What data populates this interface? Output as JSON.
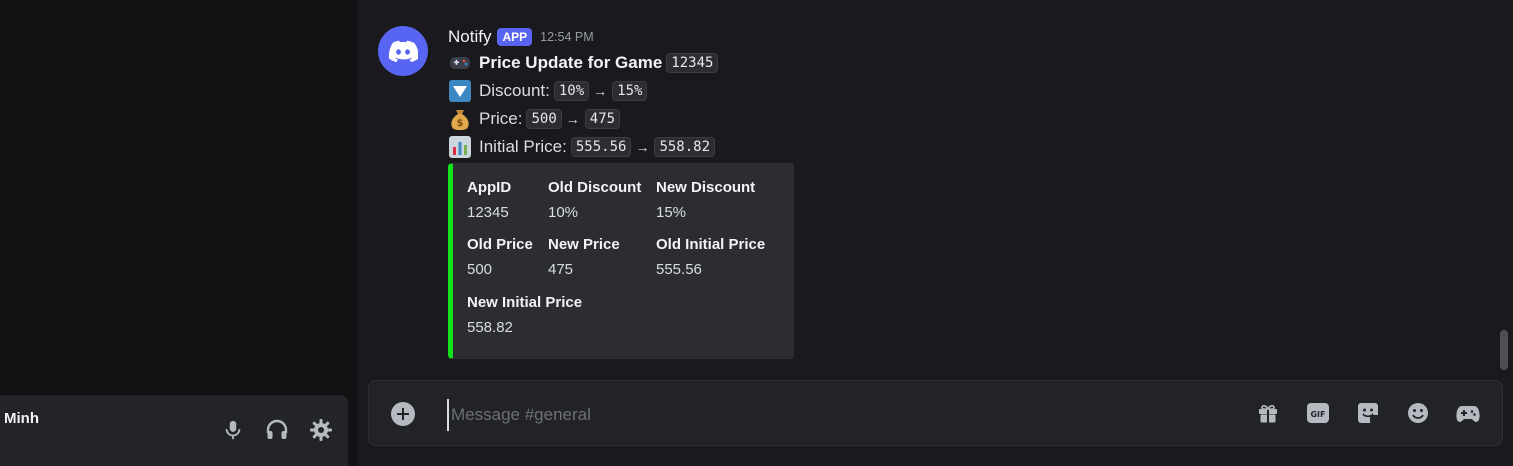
{
  "user_panel": {
    "username": "Minh"
  },
  "message": {
    "author": "Notify",
    "badge": "APP",
    "timestamp": "12:54 PM",
    "title_text": "Price Update for Game",
    "title_code": "12345",
    "discount_label": "Discount:",
    "discount_old": "10%",
    "discount_new": "15%",
    "price_label": "Price:",
    "price_old": "500",
    "price_new": "475",
    "initial_label": "Initial Price:",
    "initial_old": "555.56",
    "initial_new": "558.82",
    "arrow": "→"
  },
  "embed": {
    "accent_color": "#12e21a",
    "fields": [
      {
        "name": "AppID",
        "value": "12345"
      },
      {
        "name": "Old Discount",
        "value": "10%"
      },
      {
        "name": "New Discount",
        "value": "15%"
      },
      {
        "name": "Old Price",
        "value": "500"
      },
      {
        "name": "New Price",
        "value": "475"
      },
      {
        "name": "Old Initial Price",
        "value": "555.56"
      },
      {
        "name": "New Initial Price",
        "value": "558.82"
      }
    ]
  },
  "composer": {
    "placeholder": "Message #general"
  },
  "colors": {
    "brand": "#5865f2",
    "background": "#1a1a1e"
  }
}
